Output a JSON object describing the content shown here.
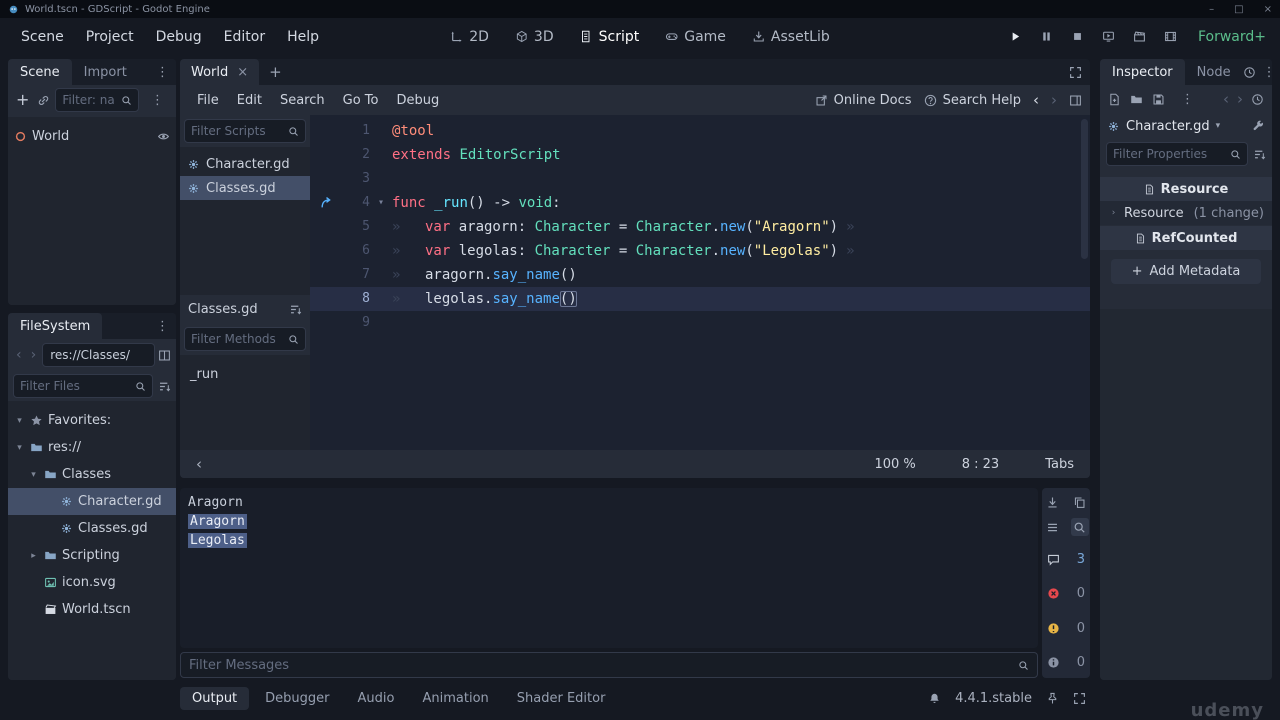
{
  "titlebar": {
    "title": "World.tscn - GDScript - Godot Engine"
  },
  "menubar": {
    "items": [
      "Scene",
      "Project",
      "Debug",
      "Editor",
      "Help"
    ],
    "workspaces": [
      {
        "label": "2D"
      },
      {
        "label": "3D"
      },
      {
        "label": "Script"
      },
      {
        "label": "Game"
      },
      {
        "label": "AssetLib"
      }
    ],
    "renderer": "Forward+"
  },
  "scene_dock": {
    "tabs": [
      "Scene",
      "Import"
    ],
    "filter_placeholder": "Filter: na",
    "tree": [
      {
        "label": "World"
      }
    ]
  },
  "filesystem": {
    "title": "FileSystem",
    "path": "res://Classes/",
    "filter_placeholder": "Filter Files",
    "tree": [
      {
        "label": "Favorites:"
      },
      {
        "label": "res://"
      },
      {
        "label": "Classes"
      },
      {
        "label": "Character.gd"
      },
      {
        "label": "Classes.gd"
      },
      {
        "label": "Scripting"
      },
      {
        "label": "icon.svg"
      },
      {
        "label": "World.tscn"
      }
    ]
  },
  "script_editor": {
    "tab": "World",
    "menus": [
      "File",
      "Edit",
      "Search",
      "Go To",
      "Debug"
    ],
    "online_docs": "Online Docs",
    "search_help": "Search Help",
    "scripts_filter": "Filter Scripts",
    "scripts": [
      {
        "label": "Character.gd"
      },
      {
        "label": "Classes.gd"
      }
    ],
    "members_header": "Classes.gd",
    "methods_filter": "Filter Methods",
    "methods": [
      {
        "label": "_run"
      }
    ],
    "status": {
      "zoom": "100 %",
      "cursor": "8 : 23",
      "indent": "Tabs"
    }
  },
  "code": {
    "lines": [
      {
        "n": 1,
        "tokens": [
          [
            "@tool",
            "ann"
          ]
        ]
      },
      {
        "n": 2,
        "tokens": [
          [
            "extends ",
            "kw"
          ],
          [
            "EditorScript",
            "type"
          ]
        ]
      },
      {
        "n": 3,
        "tokens": []
      },
      {
        "n": 4,
        "fold": true,
        "override": true,
        "tokens": [
          [
            "func ",
            "kw"
          ],
          [
            "_run",
            "fndef"
          ],
          [
            "() -> ",
            "pln"
          ],
          [
            "void",
            "type"
          ],
          [
            ":",
            "pln"
          ]
        ]
      },
      {
        "n": 5,
        "indent": true,
        "trail": true,
        "tokens": [
          [
            "var ",
            "kw"
          ],
          [
            "aragorn: ",
            "pln"
          ],
          [
            "Character",
            "type"
          ],
          [
            " = ",
            "pln"
          ],
          [
            "Character",
            "type"
          ],
          [
            ".",
            "pln"
          ],
          [
            "new",
            "fn"
          ],
          [
            "(",
            "pln"
          ],
          [
            "\"Aragorn\"",
            "str"
          ],
          [
            ")",
            "pln"
          ]
        ]
      },
      {
        "n": 6,
        "indent": true,
        "trail": true,
        "tokens": [
          [
            "var ",
            "kw"
          ],
          [
            "legolas: ",
            "pln"
          ],
          [
            "Character",
            "type"
          ],
          [
            " = ",
            "pln"
          ],
          [
            "Character",
            "type"
          ],
          [
            ".",
            "pln"
          ],
          [
            "new",
            "fn"
          ],
          [
            "(",
            "pln"
          ],
          [
            "\"Legolas\"",
            "str"
          ],
          [
            ")",
            "pln"
          ]
        ]
      },
      {
        "n": 7,
        "indent": true,
        "tokens": [
          [
            "aragorn",
            "pln"
          ],
          [
            ".",
            "pln"
          ],
          [
            "say_name",
            "fn"
          ],
          [
            "()",
            "pln"
          ]
        ]
      },
      {
        "n": 8,
        "indent": true,
        "current": true,
        "tokens": [
          [
            "legolas",
            "pln"
          ],
          [
            ".",
            "pln"
          ],
          [
            "say_name",
            "fn"
          ],
          [
            "()",
            "brk"
          ]
        ]
      },
      {
        "n": 9,
        "tokens": []
      }
    ]
  },
  "output": {
    "lines": [
      {
        "text": "Aragorn"
      },
      {
        "text": "Aragorn",
        "selected": true
      },
      {
        "text": "Legolas",
        "selected": true
      }
    ],
    "filter_placeholder": "Filter Messages",
    "counters": [
      {
        "name": "messages",
        "count": "3"
      },
      {
        "name": "errors",
        "count": "0"
      },
      {
        "name": "warnings",
        "count": "0"
      },
      {
        "name": "info",
        "count": "0"
      }
    ]
  },
  "bottombar": {
    "tabs": [
      {
        "label": "Output"
      },
      {
        "label": "Debugger"
      },
      {
        "label": "Audio"
      },
      {
        "label": "Animation"
      },
      {
        "label": "Shader Editor"
      }
    ],
    "version": "4.4.1.stable"
  },
  "inspector": {
    "tabs": [
      {
        "label": "Inspector"
      },
      {
        "label": "Node"
      }
    ],
    "resource": "Character.gd",
    "filter_placeholder": "Filter Properties",
    "sections": [
      {
        "label": "Resource"
      },
      {
        "label": "RefCounted"
      }
    ],
    "resource_row": {
      "label": "Resource",
      "change": "(1 change)"
    },
    "add_metadata": "Add Metadata"
  },
  "watermark": "udemy"
}
